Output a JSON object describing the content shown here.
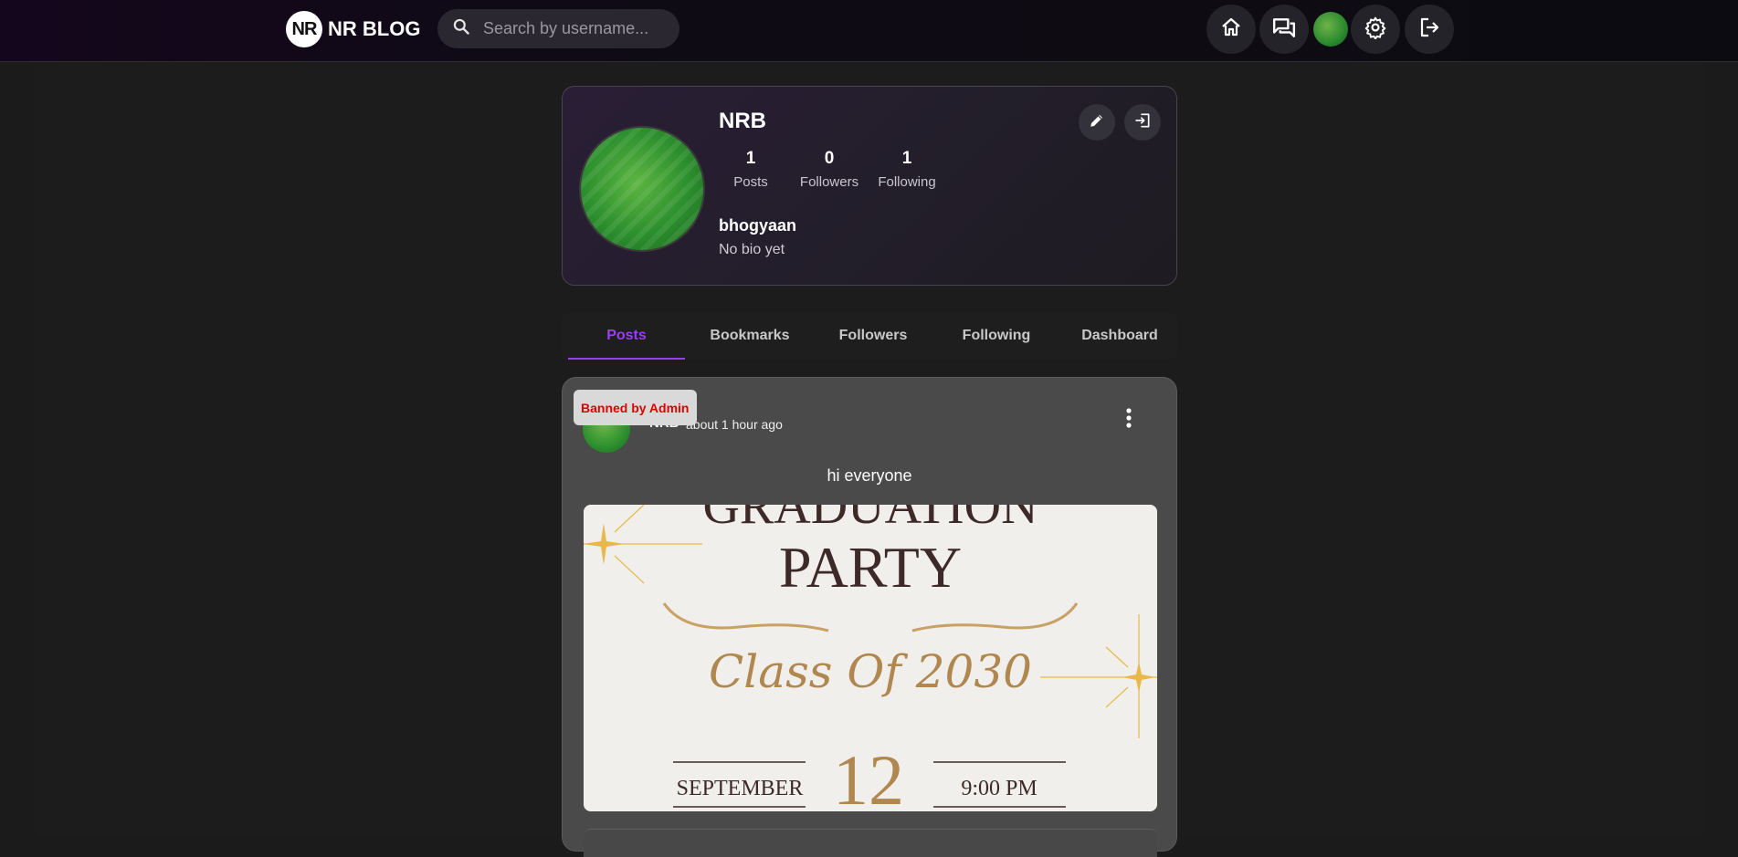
{
  "header": {
    "logo_mark": "NR",
    "logo_text": "NR BLOG",
    "search_placeholder": "Search by username...",
    "nav": [
      "home-icon",
      "chat-icon",
      "avatar",
      "gear-icon",
      "logout-icon"
    ]
  },
  "profile": {
    "name": "NRB",
    "stats": [
      {
        "value": "1",
        "label": "Posts"
      },
      {
        "value": "0",
        "label": "Followers"
      },
      {
        "value": "1",
        "label": "Following"
      }
    ],
    "username": "bhogyaan",
    "bio": "No bio yet",
    "actions": [
      "edit-icon",
      "leave-icon"
    ]
  },
  "tabs": {
    "items": [
      "Posts",
      "Bookmarks",
      "Followers",
      "Following",
      "Dashboard"
    ],
    "active": "Posts"
  },
  "post": {
    "badge": "Banned by Admin",
    "author": "NRB",
    "time": "about 1 hour ago",
    "text": "hi everyone",
    "image": {
      "line1": "GRADUATION",
      "line2": "PARTY",
      "subtitle": "Class Of 2030",
      "month": "SEPTEMBER",
      "day": "12",
      "time": "9:00 PM"
    }
  },
  "colors": {
    "accent": "#9b3df0",
    "banned": "#e00000",
    "gold": "#b0874f"
  }
}
